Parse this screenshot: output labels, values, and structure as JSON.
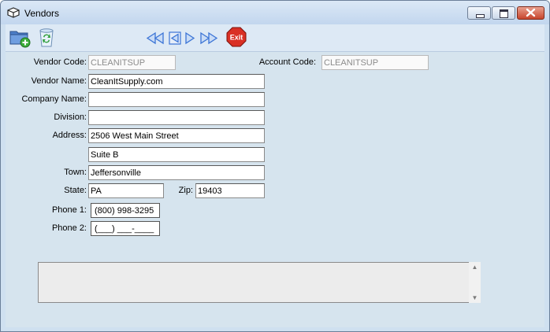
{
  "window": {
    "title": "Vendors"
  },
  "titlebar_buttons": {
    "minimize": "minimize-icon",
    "maximize": "maximize-icon",
    "close": "close-icon"
  },
  "toolbar": {
    "icons": [
      "add-folder-icon",
      "recycle-bin-icon"
    ],
    "nav": [
      "first-record-icon",
      "previous-record-icon",
      "next-record-icon",
      "last-record-icon"
    ],
    "exit_label": "Exit"
  },
  "form": {
    "vendor_code": {
      "label": "Vendor Code:",
      "value": "CLEANITSUP"
    },
    "account_code": {
      "label": "Account Code:",
      "value": "CLEANITSUP"
    },
    "vendor_name": {
      "label": "Vendor Name:",
      "value": "CleanItSupply.com"
    },
    "company_name": {
      "label": "Company Name:",
      "value": ""
    },
    "division": {
      "label": "Division:",
      "value": ""
    },
    "address": {
      "label": "Address:",
      "line1": "2506 West Main Street",
      "line2": "Suite B"
    },
    "town": {
      "label": "Town:",
      "value": "Jeffersonville"
    },
    "state": {
      "label": "State:",
      "value": "PA"
    },
    "zip": {
      "label": "Zip:",
      "value": "19403"
    },
    "phone1": {
      "label": "Phone 1:",
      "value": "(800) 998-3295"
    },
    "phone2": {
      "label": "Phone 2:",
      "value": "(___) ___-____"
    }
  },
  "memo": {
    "value": ""
  },
  "colors": {
    "window_bg": "#cfe0f0",
    "content_bg": "#d6e4ee",
    "exit_red": "#d93025",
    "nav_blue": "#3b74d6"
  }
}
